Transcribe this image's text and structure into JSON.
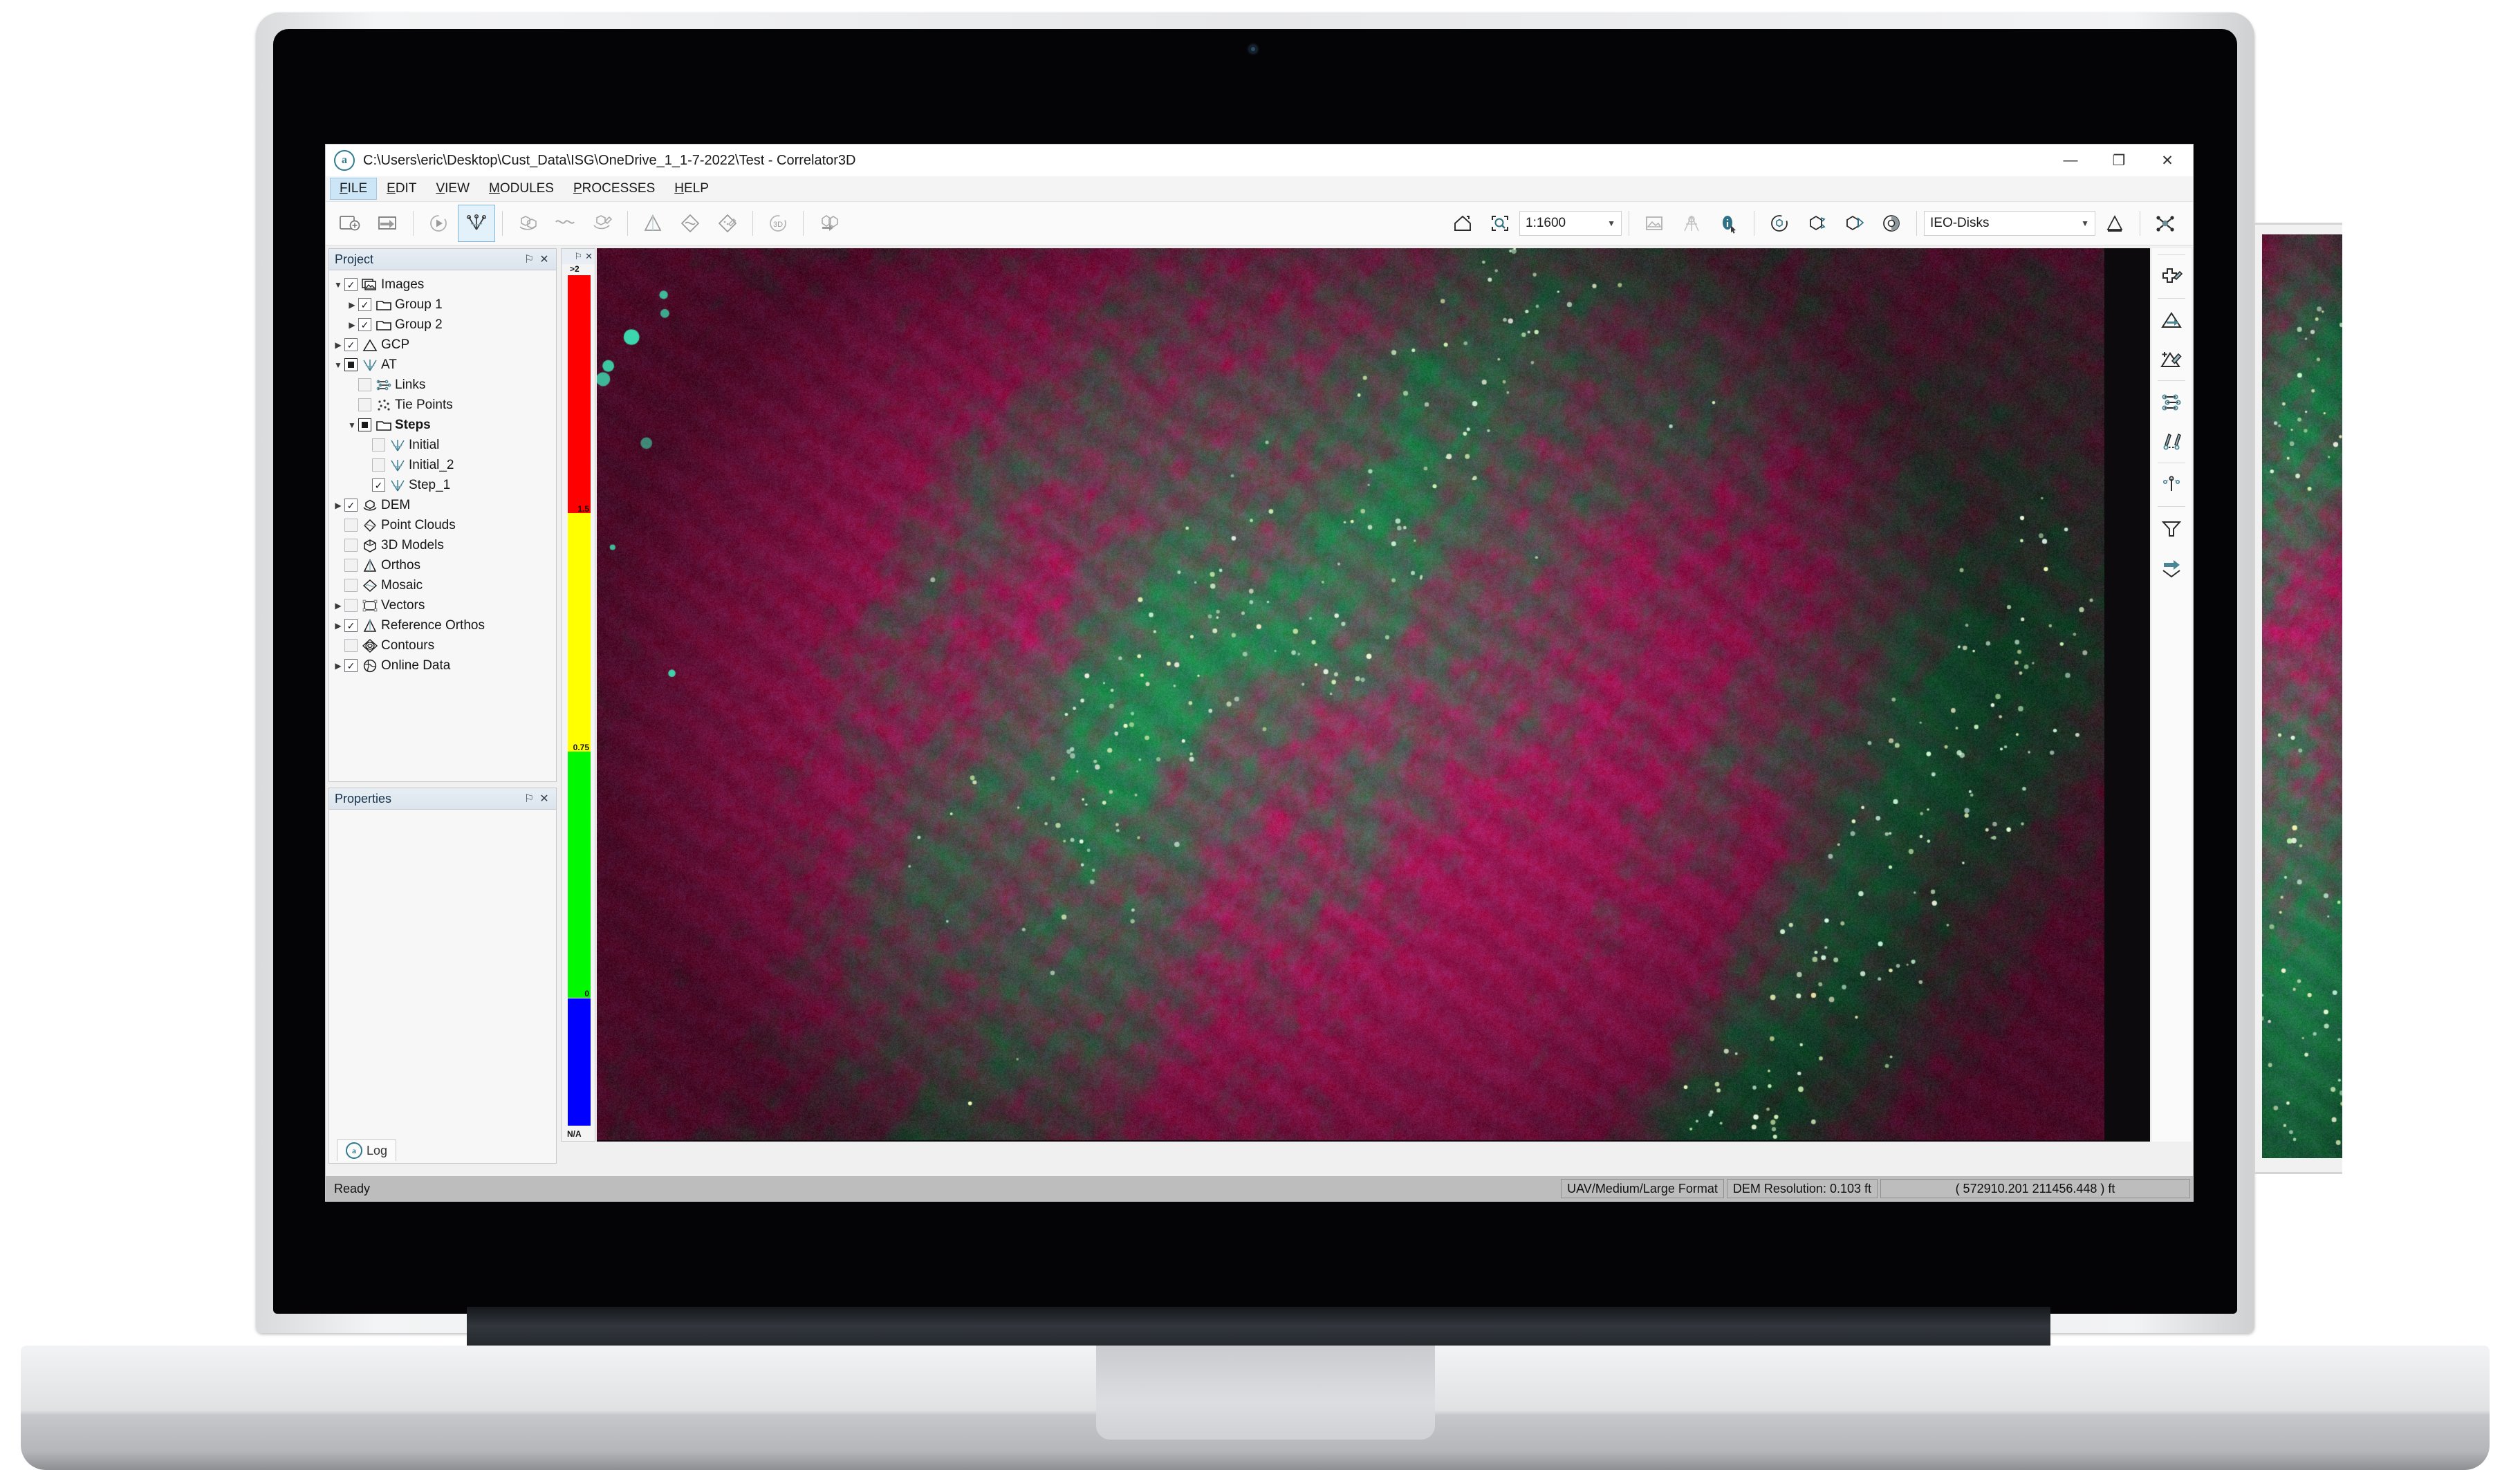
{
  "window": {
    "title": "C:\\Users\\eric\\Desktop\\Cust_Data\\ISG\\OneDrive_1_1-7-2022\\Test - Correlator3D",
    "logo_glyph": "a",
    "controls": {
      "minimize": "—",
      "maximize": "❐",
      "close": "✕"
    }
  },
  "menubar": [
    {
      "label": "FILE",
      "active": true
    },
    {
      "label": "EDIT",
      "active": false
    },
    {
      "label": "VIEW",
      "active": false
    },
    {
      "label": "MODULES",
      "active": false
    },
    {
      "label": "PROCESSES",
      "active": false
    },
    {
      "label": "HELP",
      "active": false
    }
  ],
  "toolbar": {
    "left_buttons": [
      {
        "name": "new-project-icon",
        "tip": "New Project"
      },
      {
        "name": "open-project-icon",
        "tip": "Open Project"
      },
      {
        "name": "run-process-icon",
        "tip": "Run"
      },
      {
        "name": "aerial-triangulation-icon",
        "tip": "Aerial Triangulation",
        "selected": true
      },
      {
        "name": "point-cloud-icon",
        "tip": "Point Cloud"
      },
      {
        "name": "dem-surface-icon",
        "tip": "DEM"
      },
      {
        "name": "dem-edit-icon",
        "tip": "DEM Edit"
      },
      {
        "name": "ortho-icon",
        "tip": "Orthos"
      },
      {
        "name": "mosaic-icon",
        "tip": "Mosaic"
      },
      {
        "name": "mosaic-edit-icon",
        "tip": "Mosaic Edit"
      },
      {
        "name": "three-d-icon",
        "tip": "3D"
      },
      {
        "name": "export-3d-icon",
        "tip": "Export 3D"
      }
    ],
    "right_buttons": [
      {
        "name": "home-view-icon",
        "tip": "Home View"
      },
      {
        "name": "zoom-to-extent-icon",
        "tip": "Zoom To Extent"
      }
    ],
    "scale_value": "1:1600",
    "view_buttons": [
      {
        "name": "image-view-icon",
        "tip": "Image View"
      },
      {
        "name": "stereo-view-icon",
        "tip": "Stereo View"
      },
      {
        "name": "info-tool-icon",
        "tip": "Info Tool",
        "active": true
      },
      {
        "name": "rotate-globe-icon",
        "tip": "Rotate"
      },
      {
        "name": "cube-rotate-icon",
        "tip": "Cube Rotate"
      },
      {
        "name": "cube-flip-icon",
        "tip": "Cube Flip"
      },
      {
        "name": "shading-icon",
        "tip": "Shading"
      }
    ],
    "layer_select_value": "IEO-Disks",
    "end_buttons": [
      {
        "name": "ortho-pyramid-icon",
        "tip": "Ortho"
      },
      {
        "name": "network-icon",
        "tip": "Network"
      }
    ]
  },
  "project_panel": {
    "title": "Project",
    "pin_glyph": "⚐",
    "close_glyph": "✕",
    "tree": [
      {
        "label": "Images",
        "indent": 0,
        "expander": "down",
        "check": "on",
        "icon": "images-icon",
        "bold": false
      },
      {
        "label": "Group 1",
        "indent": 1,
        "expander": "right",
        "check": "on",
        "icon": "folder-icon",
        "bold": false
      },
      {
        "label": "Group 2",
        "indent": 1,
        "expander": "right",
        "check": "on",
        "icon": "folder-icon",
        "bold": false
      },
      {
        "label": "GCP",
        "indent": 0,
        "expander": "right",
        "check": "on",
        "icon": "gcp-triangle-icon",
        "bold": false
      },
      {
        "label": "AT",
        "indent": 0,
        "expander": "down",
        "check": "part",
        "icon": "at-icon",
        "bold": false
      },
      {
        "label": "Links",
        "indent": 1,
        "expander": "none",
        "check": "off",
        "icon": "links-icon",
        "bold": false
      },
      {
        "label": "Tie Points",
        "indent": 1,
        "expander": "none",
        "check": "off",
        "icon": "tie-points-icon",
        "bold": false
      },
      {
        "label": "Steps",
        "indent": 1,
        "expander": "down",
        "check": "part",
        "icon": "folder-icon",
        "bold": true
      },
      {
        "label": "Initial",
        "indent": 2,
        "expander": "none",
        "check": "off",
        "icon": "at-icon",
        "bold": false
      },
      {
        "label": "Initial_2",
        "indent": 2,
        "expander": "none",
        "check": "off",
        "icon": "at-icon",
        "bold": false
      },
      {
        "label": "Step_1",
        "indent": 2,
        "expander": "none",
        "check": "on",
        "icon": "at-icon",
        "bold": false
      },
      {
        "label": "DEM",
        "indent": 0,
        "expander": "right",
        "check": "on",
        "icon": "dem-icon",
        "bold": false
      },
      {
        "label": "Point Clouds",
        "indent": 0,
        "expander": "none",
        "check": "off",
        "icon": "point-clouds-icon",
        "bold": false
      },
      {
        "label": "3D Models",
        "indent": 0,
        "expander": "none",
        "check": "off",
        "icon": "cube-icon",
        "bold": false
      },
      {
        "label": "Orthos",
        "indent": 0,
        "expander": "none",
        "check": "off",
        "icon": "ortho-icon",
        "bold": false
      },
      {
        "label": "Mosaic",
        "indent": 0,
        "expander": "none",
        "check": "off",
        "icon": "mosaic-icon",
        "bold": false
      },
      {
        "label": "Vectors",
        "indent": 0,
        "expander": "right",
        "check": "off",
        "icon": "vectors-icon",
        "bold": false
      },
      {
        "label": "Reference Orthos",
        "indent": 0,
        "expander": "right",
        "check": "on",
        "icon": "ortho-icon",
        "bold": false
      },
      {
        "label": "Contours",
        "indent": 0,
        "expander": "none",
        "check": "off",
        "icon": "contours-icon",
        "bold": false
      },
      {
        "label": "Online Data",
        "indent": 0,
        "expander": "right",
        "check": "on",
        "icon": "globe-icon",
        "bold": false
      }
    ]
  },
  "properties_panel": {
    "title": "Properties",
    "pin_glyph": "⚐",
    "close_glyph": "✕"
  },
  "log_tab": {
    "label": "Log",
    "logo_glyph": "a"
  },
  "legend": {
    "pin_glyph": "⚐",
    "close_glyph": "✕",
    "top_label": ">2",
    "bottom_label": "N/A",
    "stops": [
      {
        "label": "1.5",
        "color": "#fe0000"
      },
      {
        "label": "0.75",
        "color": "#ffff00"
      },
      {
        "label": "0",
        "color": "#00f900"
      },
      {
        "label": "",
        "color": "#0000fe"
      }
    ]
  },
  "right_toolbar": [
    {
      "name": "add-gcp-icon",
      "tip": "Add GCP"
    },
    {
      "name": "move-triangle-icon",
      "tip": "Move Point"
    },
    {
      "name": "add-edit-tin-icon",
      "tip": "Add / Edit TIN"
    },
    {
      "name": "links-icon",
      "tip": "Links"
    },
    {
      "name": "measure-pair-icon",
      "tip": "Measure Pair"
    },
    {
      "name": "ray-point-icon",
      "tip": "Ray Point"
    },
    {
      "name": "filter-icon",
      "tip": "Filter"
    },
    {
      "name": "next-arrow-icon",
      "tip": "Next"
    }
  ],
  "statusbar": {
    "ready_text": "Ready",
    "format_text": "UAV/Medium/Large Format",
    "dem_resolution_text": "DEM Resolution: 0.103 ft",
    "coordinates_text": "( 572910.201 211456.448 ) ft"
  }
}
